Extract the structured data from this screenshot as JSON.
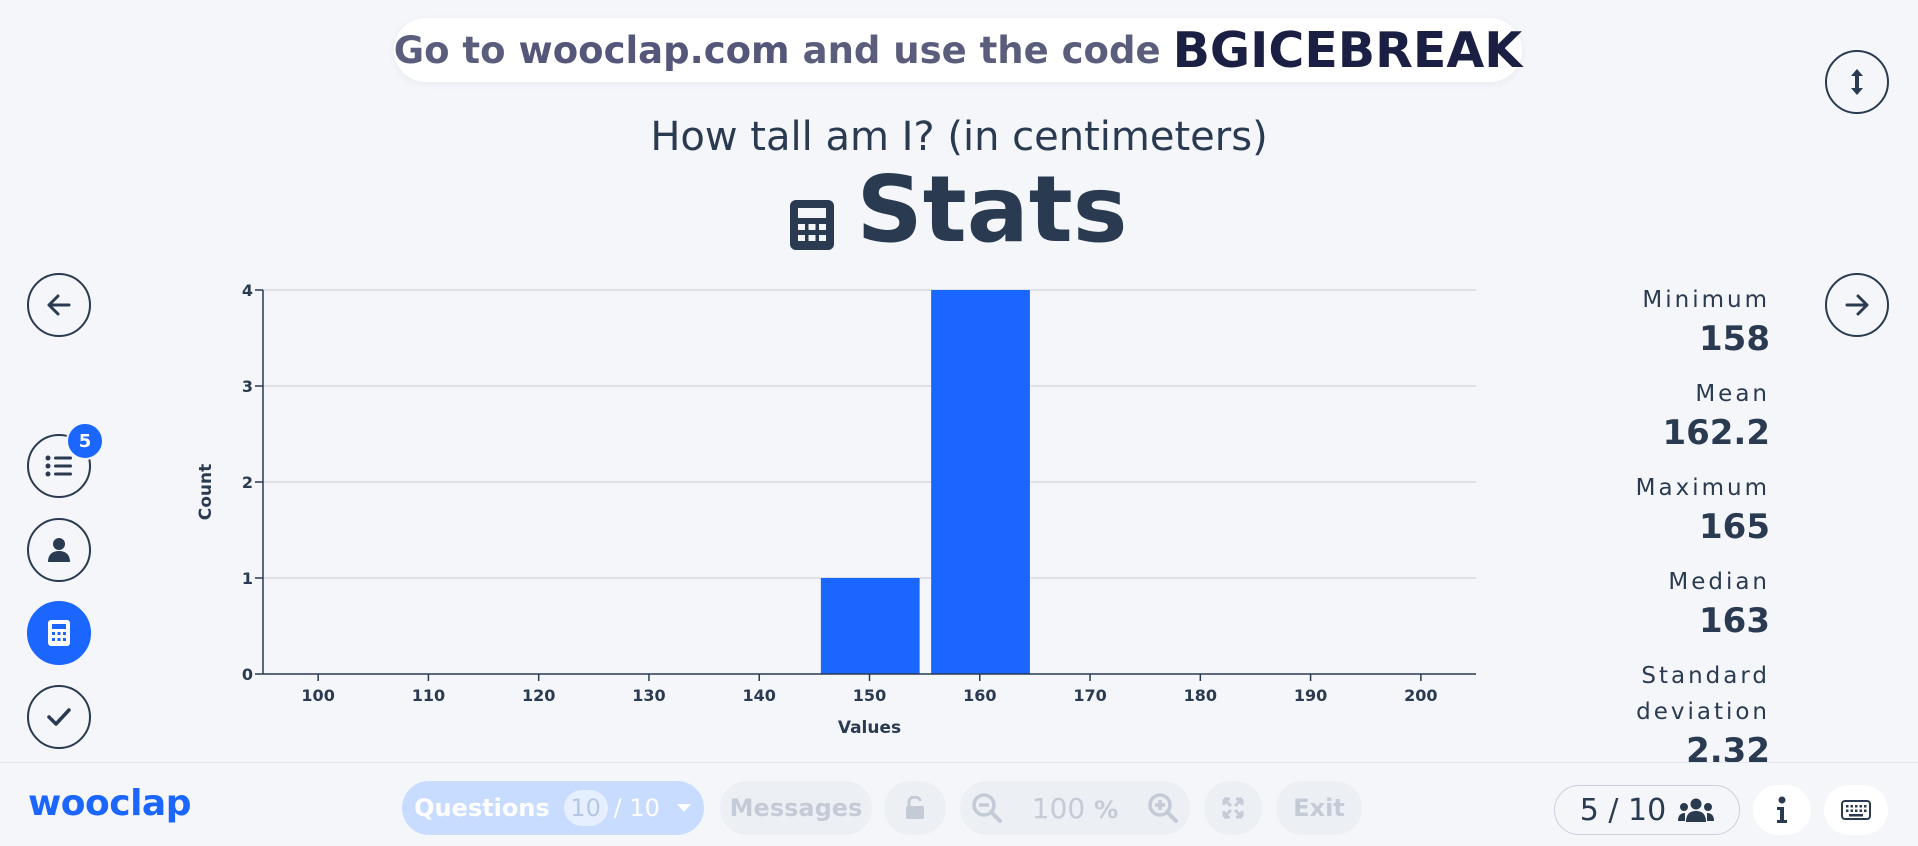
{
  "banner": {
    "prefix": "Go to",
    "site": "wooclap.com",
    "middle": "and use the code",
    "code": "BGICEBREAK"
  },
  "question": {
    "title": "How tall am I? (in centimeters)",
    "section": "Stats"
  },
  "sidebar": {
    "questions_badge": "5"
  },
  "stats": [
    {
      "label": "Minimum",
      "value": "158"
    },
    {
      "label": "Mean",
      "value": "162.2"
    },
    {
      "label": "Maximum",
      "value": "165"
    },
    {
      "label": "Median",
      "value": "163"
    },
    {
      "label": "Standard deviation",
      "value": "2.32"
    }
  ],
  "chart_data": {
    "type": "bar",
    "xlabel": "Values",
    "ylabel": "Count",
    "x_ticks": [
      100,
      110,
      120,
      130,
      140,
      150,
      160,
      170,
      180,
      190,
      200
    ],
    "y_ticks": [
      0,
      1,
      2,
      3,
      4
    ],
    "xlim": [
      95,
      205
    ],
    "ylim": [
      0,
      4
    ],
    "grid": true,
    "bars": [
      {
        "x0": 145,
        "x1": 155,
        "count": 1
      },
      {
        "x0": 155,
        "x1": 165,
        "count": 4
      }
    ],
    "bar_color": "#1a66ff"
  },
  "footer": {
    "logo": "wooclap",
    "questions_label": "Questions",
    "questions_current": "10",
    "questions_total": "/ 10",
    "messages_label": "Messages",
    "zoom_value": "100",
    "zoom_unit": "%",
    "exit_label": "Exit",
    "participants": "5 / 10"
  },
  "colors": {
    "accent": "#1a66ff",
    "text": "#2a3a50",
    "background": "#f4f6fa"
  }
}
